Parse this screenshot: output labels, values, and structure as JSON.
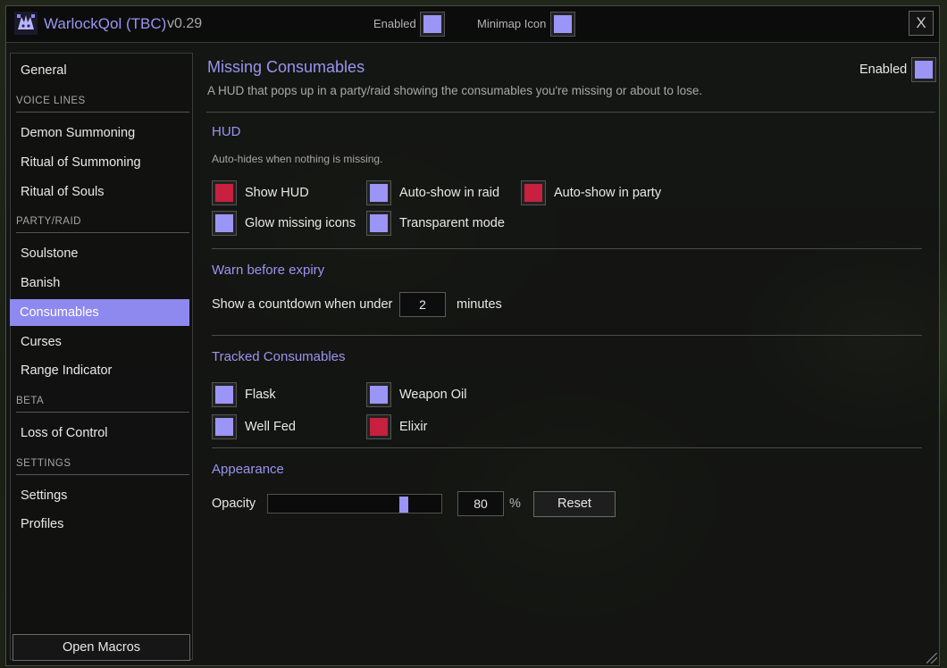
{
  "header": {
    "app_title": "WarlockQol (TBC)",
    "version": "v0.29",
    "enabled_label": "Enabled",
    "enabled": true,
    "minimap_label": "Minimap Icon",
    "minimap": true,
    "close_label": "X"
  },
  "sidebar": {
    "general": "General",
    "voice_lines": "VOICE LINES",
    "demon_summoning": "Demon Summoning",
    "ritual_summoning": "Ritual of Summoning",
    "ritual_souls": "Ritual of Souls",
    "party_raid": "PARTY/RAID",
    "soulstone": "Soulstone",
    "banish": "Banish",
    "consumables": "Consumables",
    "curses": "Curses",
    "range_indicator": "Range Indicator",
    "beta": "BETA",
    "loss_of_control": "Loss of Control",
    "settings_section": "SETTINGS",
    "settings": "Settings",
    "profiles": "Profiles",
    "open_macros": "Open Macros",
    "active_item": "Consumables"
  },
  "page": {
    "title": "Missing Consumables",
    "description": "A HUD that pops up in a party/raid showing the consumables you're missing or about to lose.",
    "enabled_label": "Enabled",
    "enabled": true
  },
  "hud": {
    "title": "HUD",
    "description": "Auto-hides when nothing is missing.",
    "show_hud": {
      "label": "Show HUD",
      "checked": false
    },
    "auto_show_raid": {
      "label": "Auto-show in raid",
      "checked": true
    },
    "auto_show_party": {
      "label": "Auto-show in party",
      "checked": false
    },
    "glow_missing": {
      "label": "Glow missing icons",
      "checked": true
    },
    "transparent_mode": {
      "label": "Transparent mode",
      "checked": true
    }
  },
  "warn": {
    "title": "Warn before expiry",
    "label_before": "Show a countdown when under",
    "value": "2",
    "label_after": "minutes"
  },
  "tracked": {
    "title": "Tracked Consumables",
    "flask": {
      "label": "Flask",
      "checked": true
    },
    "weapon_oil": {
      "label": "Weapon Oil",
      "checked": true
    },
    "well_fed": {
      "label": "Well Fed",
      "checked": true
    },
    "elixir": {
      "label": "Elixir",
      "checked": false
    }
  },
  "appearance": {
    "title": "Appearance",
    "opacity_label": "Opacity",
    "opacity_value": "80",
    "opacity_fraction": 0.8,
    "percent": "%",
    "reset_label": "Reset"
  },
  "colors": {
    "accent": "#9b95f6",
    "unchecked": "#c8203f",
    "title_text": "#9a94f0"
  }
}
